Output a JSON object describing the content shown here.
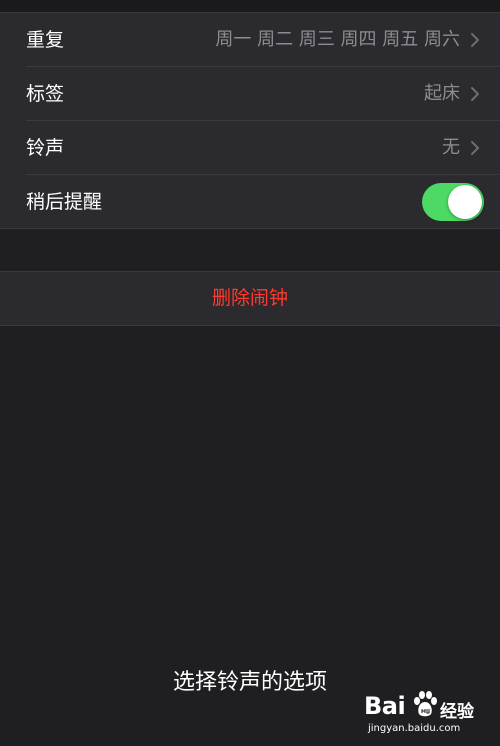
{
  "settings": {
    "repeat": {
      "label": "重复",
      "value": "周一 周二 周三 周四 周五 周六"
    },
    "tag": {
      "label": "标签",
      "value": "起床"
    },
    "ringtone": {
      "label": "铃声",
      "value": "无"
    },
    "snooze": {
      "label": "稍后提醒",
      "enabled": true
    }
  },
  "delete_label": "删除闹钟",
  "caption": "选择铃声的选项",
  "watermark": {
    "brand": "Bai",
    "brand2": "经验",
    "domain": "jingyan.baidu.com"
  },
  "colors": {
    "toggle_on": "#4cd964",
    "destructive": "#ff3b30",
    "value_text": "#8d8c91"
  },
  "icons": {
    "chevron": "chevron-right-icon",
    "paw": "baidu-paw-icon"
  }
}
